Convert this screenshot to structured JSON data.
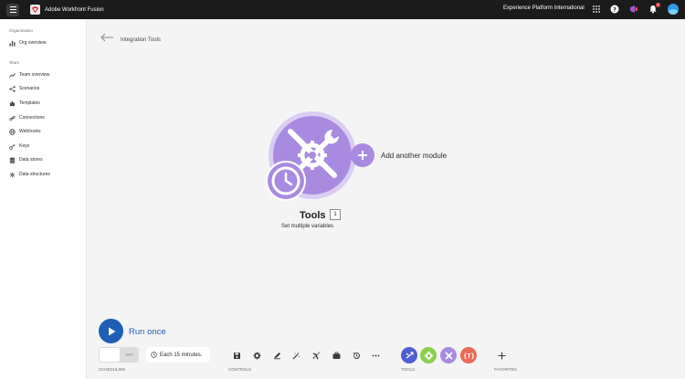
{
  "header": {
    "app_title": "Adobe Workfront Fusion",
    "org_name": "Experience Platform International",
    "notification_count": "1"
  },
  "sidebar": {
    "organization_label": "Organization",
    "org_items": [
      {
        "label": "Org overview",
        "icon": "bar-chart-icon"
      }
    ],
    "team_label": "Team",
    "team_items": [
      {
        "label": "Team overview",
        "icon": "trend-icon"
      },
      {
        "label": "Scenarios",
        "icon": "share-icon"
      },
      {
        "label": "Templates",
        "icon": "puzzle-icon"
      },
      {
        "label": "Connections",
        "icon": "link-icon"
      },
      {
        "label": "Webhooks",
        "icon": "globe-icon"
      },
      {
        "label": "Keys",
        "icon": "key-icon"
      },
      {
        "label": "Data stores",
        "icon": "database-icon"
      },
      {
        "label": "Data structures",
        "icon": "structure-icon"
      }
    ]
  },
  "breadcrumb": {
    "title": "Integration Tools"
  },
  "module": {
    "name": "Tools",
    "count": "1",
    "subtitle": "Set multiple variables",
    "add_label": "Add another module",
    "color": "#a88be0"
  },
  "controls": {
    "run_label": "Run once",
    "toggle_state": "OFF",
    "schedule_label": "Each 15 minutes.",
    "scheduling_label": "SCHEDULING",
    "controls_label": "CONTROLS",
    "tools_label": "TOOLS",
    "favorites_label": "FAVORITES",
    "run_color": "#1e5fb5"
  }
}
